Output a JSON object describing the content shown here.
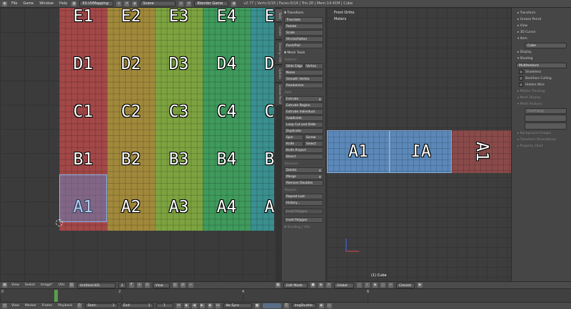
{
  "top_menu": [
    "File",
    "Game",
    "Window",
    "Help"
  ],
  "screen_layout": "50.UVMapping",
  "scene": "Scene",
  "render_engine": "Blender Game",
  "stats": "v2.77 | Verts:0/16 | Faces:0/14 | Tris:28 | Mem:14.41M | Cube",
  "uv_grid": {
    "rows": [
      {
        "row": "E",
        "labels": [
          "E1",
          "E2",
          "E3",
          "E4",
          "E5"
        ]
      },
      {
        "row": "D",
        "labels": [
          "D1",
          "D2",
          "D3",
          "D4",
          "D5"
        ]
      },
      {
        "row": "C",
        "labels": [
          "C1",
          "C2",
          "C3",
          "C4",
          "C5"
        ]
      },
      {
        "row": "B",
        "labels": [
          "B1",
          "B2",
          "B3",
          "B4",
          "B5"
        ]
      },
      {
        "row": "A",
        "labels": [
          "A1",
          "A2",
          "A3",
          "A4",
          "A5"
        ]
      }
    ],
    "column_colors": [
      "#a34848",
      "#a1893c",
      "#7da340",
      "#3f9a5c",
      "#3a8f8f"
    ],
    "selected_face": "A1"
  },
  "tool_tabs": [
    "Tools",
    "Create",
    "Shading / UVs",
    "Options",
    "Grease Pencil"
  ],
  "tool_shelf": {
    "transform_header": "Transform",
    "transform_tools": [
      "Translate",
      "Rotate",
      "Scale",
      "Shrink/Fatten",
      "Push/Pull"
    ],
    "mesh_tools_header": "Mesh Tools",
    "deform_label": "Deform:",
    "slide_edge": "Slide Edge",
    "vertex": "Vertex",
    "noise": "Noise",
    "smooth_vertex": "Smooth Vertex",
    "randomize": "Randomize",
    "add_label": "Add:",
    "extrude": "Extrude",
    "add_tools": [
      "Extrude Region",
      "Extrude Individual",
      "Subdivide",
      "Loop Cut and Slide",
      "Duplicate"
    ],
    "spin": "Spin",
    "screw": "Screw",
    "knife": "Knife",
    "select": "Select",
    "knife_project": "Knife Project",
    "bisect": "Bisect",
    "remove_label": "Remove:",
    "delete": "Delete",
    "merge": "Merge",
    "remove_doubles": "Remove Doubles",
    "repeat_label": "Repeat:",
    "repeat_last": "Repeat Last",
    "history": "History...",
    "inset_polygon_dim": "Inset Polygon",
    "inset_polygon": "Inset Polygon",
    "shading_uvs_header": "Shading / UVs"
  },
  "viewport": {
    "view_name": "Front Ortho",
    "units": "Meters",
    "faces": [
      "A1",
      "A1",
      "A1"
    ],
    "object_label": "(1) Cube"
  },
  "properties": {
    "rows_top": [
      "Transform",
      "Grease Pencil",
      "View",
      "3D Cursor"
    ],
    "item_label": "Item",
    "object_name": "Cube",
    "rows_mid": [
      "Display",
      "Shading"
    ],
    "shading_mode": "Multitexture",
    "checks": [
      "Shadeless",
      "Backface Culling",
      "Hidden Wire"
    ],
    "rows_bottom": [
      "Motion Tracking",
      "Mesh Display",
      "Mesh Analysis"
    ],
    "overhang": "Overhang",
    "rows_end": [
      "Background Images",
      "Transform Orientations",
      "Property Chart"
    ]
  },
  "uv_header": {
    "menus": [
      "View",
      "Select",
      "Image*",
      "UVs"
    ],
    "image_name": "Untitled.001",
    "image_users": "2",
    "view_label": "View"
  },
  "vp_header": {
    "mode": "Edit Mode",
    "orientation": "Global",
    "snap": "Closest"
  },
  "timeline": {
    "ticks": [
      "0",
      "2",
      "4",
      "6"
    ],
    "current_frame_marker": "1"
  },
  "timeline_header": {
    "menus": [
      "View",
      "Marker",
      "Frame",
      "Playback"
    ],
    "start_label": "Start:",
    "start_value": "1",
    "end_label": "End:",
    "end_value": "1",
    "current": "1",
    "sync": "No Sync",
    "keying_set": "ImgShuttle"
  }
}
